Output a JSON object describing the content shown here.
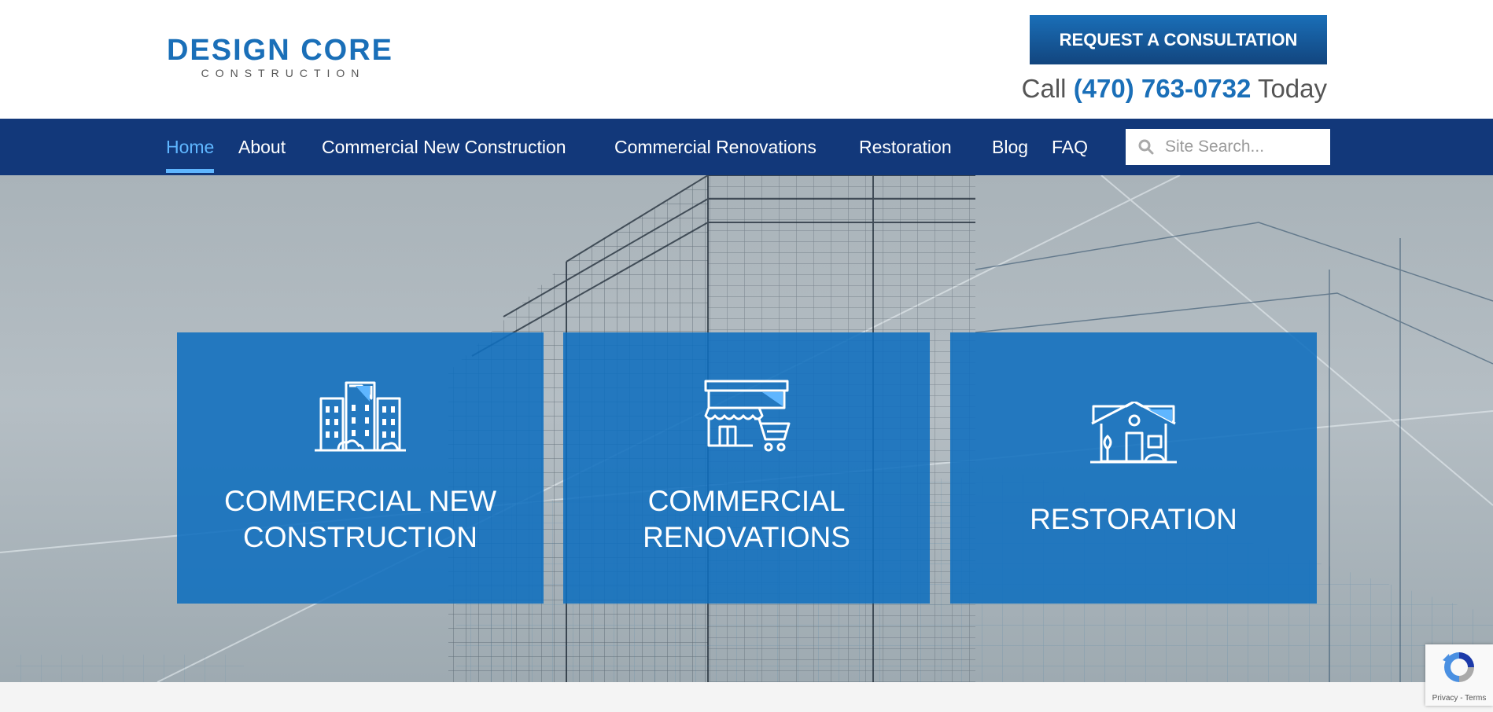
{
  "header": {
    "logo_main": "DESIGN CORE",
    "logo_sub": "CONSTRUCTION",
    "cta_label": "REQUEST A CONSULTATION",
    "call_prefix": "Call",
    "phone": "(470) 763-0732",
    "call_suffix": "Today"
  },
  "nav": {
    "items": [
      {
        "label": "Home",
        "active": true
      },
      {
        "label": "About"
      },
      {
        "label": "Commercial New Construction"
      },
      {
        "label": "Commercial Renovations"
      },
      {
        "label": "Restoration"
      },
      {
        "label": "Blog"
      },
      {
        "label": "FAQ"
      }
    ],
    "search": {
      "placeholder": "Site Search...",
      "icon": "search-icon"
    }
  },
  "hero": {
    "cards": [
      {
        "title": "COMMERCIAL NEW\nCONSTRUCTION",
        "icon": "office-buildings-icon"
      },
      {
        "title": "COMMERCIAL\nRENOVATIONS",
        "icon": "storefront-cart-icon"
      },
      {
        "title": "RESTORATION",
        "icon": "house-icon"
      }
    ]
  },
  "recaptcha": {
    "text": "Privacy - Terms",
    "icon": "recaptcha-icon"
  },
  "colors": {
    "brand_blue": "#1a6fb8",
    "nav_bg": "#12387a",
    "nav_active": "#5fb6ff",
    "card_bg": "#0f6ebe"
  }
}
